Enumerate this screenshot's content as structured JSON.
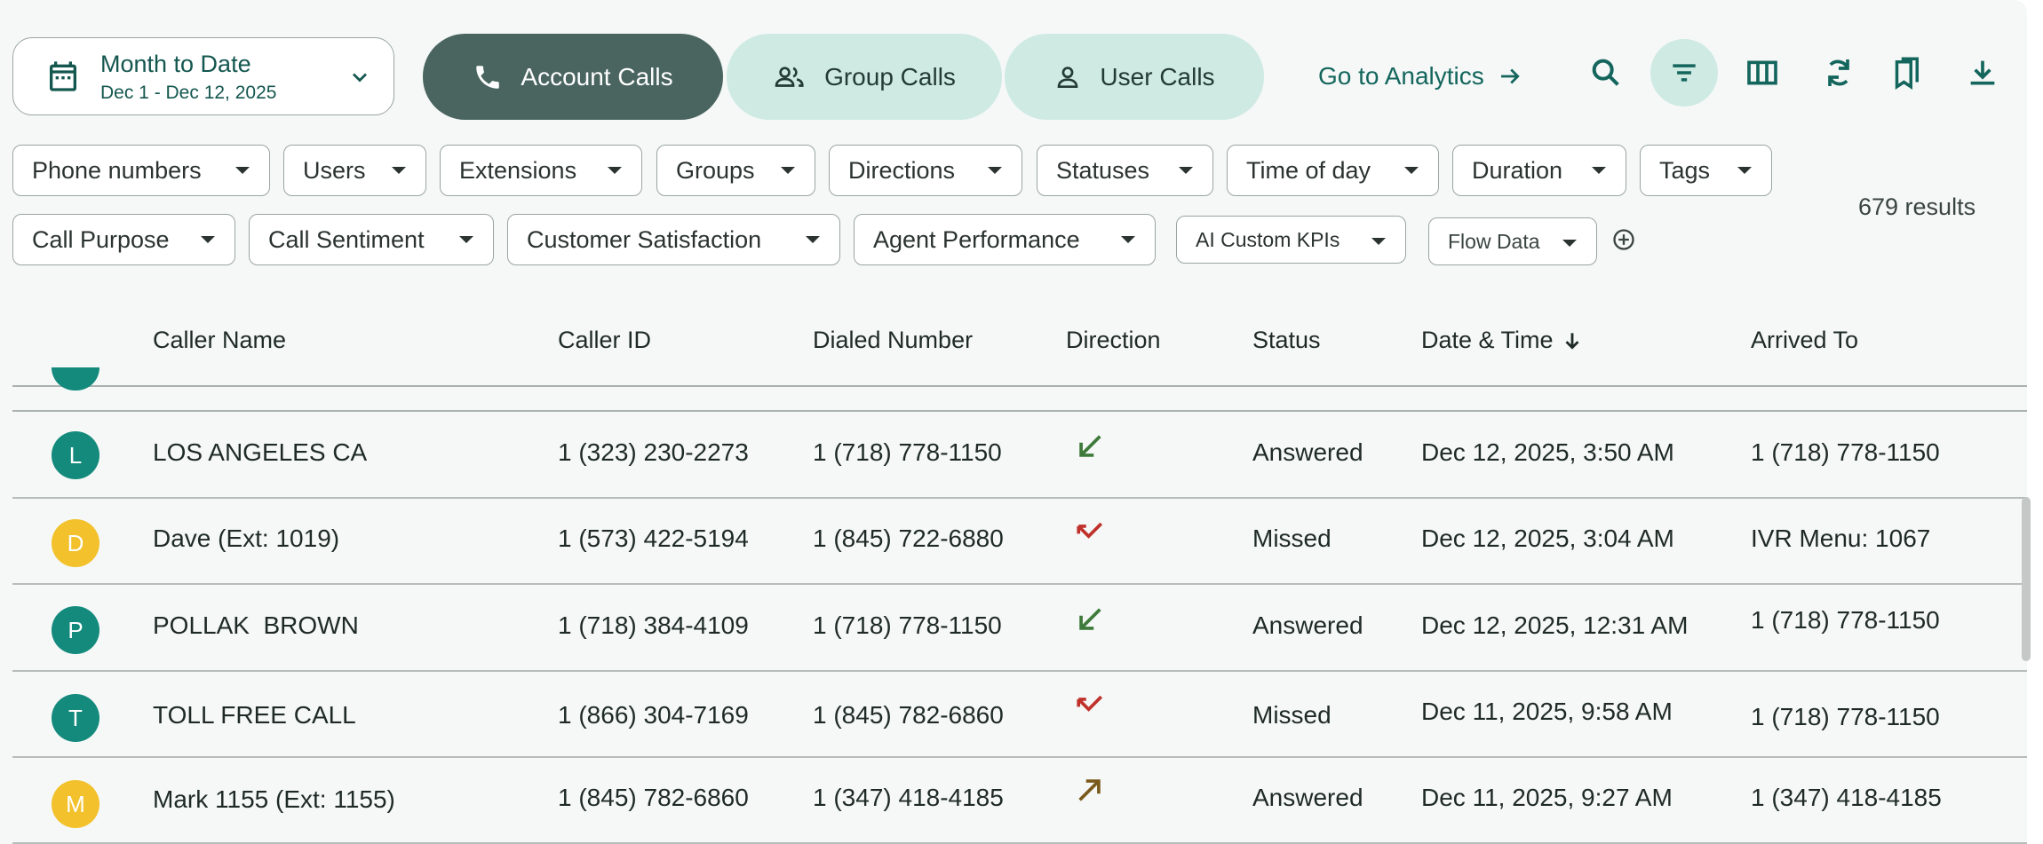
{
  "date_range": {
    "title": "Month to Date",
    "range": "Dec 1 - Dec 12, 2025"
  },
  "tabs": [
    {
      "label": "Account Calls",
      "active": true
    },
    {
      "label": "Group Calls",
      "active": false
    },
    {
      "label": "User Calls",
      "active": false
    }
  ],
  "analytics_link": "Go to Analytics",
  "toolbar_icons": [
    "search-icon",
    "filter-icon",
    "columns-icon",
    "refresh-icon",
    "bookmarks-icon",
    "download-icon"
  ],
  "filters_row1": [
    "Phone numbers",
    "Users",
    "Extensions",
    "Groups",
    "Directions",
    "Statuses",
    "Time of day",
    "Duration",
    "Tags"
  ],
  "filters_row2": [
    "Call Purpose",
    "Call Sentiment",
    "Customer Satisfaction",
    "Agent Performance",
    "AI Custom KPIs",
    "Flow Data"
  ],
  "results": "679 results",
  "columns": [
    "Caller Name",
    "Caller ID",
    "Dialed Number",
    "Direction",
    "Status",
    "Date & Time",
    "Arrived To"
  ],
  "sort": {
    "column": "Date & Time",
    "order": "descending"
  },
  "rows": [
    {
      "initial": "L",
      "name": "LOS ANGELES CA",
      "caller_id": "1 (323) 230-2273",
      "dialed": "1 (718) 778-1150",
      "direction": "incoming",
      "status": "Answered",
      "datetime": "Dec 12, 2025, 3:50 AM",
      "arrived": "1 (718) 778-1150"
    },
    {
      "initial": "D",
      "name": "Dave (Ext: 1019)",
      "caller_id": "1 (573) 422-5194",
      "dialed": "1 (845) 722-6880",
      "direction": "missed",
      "status": "Missed",
      "datetime": "Dec 12, 2025, 3:04 AM",
      "arrived": "IVR Menu: 1067"
    },
    {
      "initial": "P",
      "name": "POLLAK  BROWN",
      "caller_id": "1 (718) 384-4109",
      "dialed": "1 (718) 778-1150",
      "direction": "incoming",
      "status": "Answered",
      "datetime": "Dec 12, 2025, 12:31 AM",
      "arrived": "1 (718) 778-1150"
    },
    {
      "initial": "T",
      "name": "TOLL FREE CALL",
      "caller_id": "1 (866) 304-7169",
      "dialed": "1 (845) 782-6860",
      "direction": "missed",
      "status": "Missed",
      "datetime": "Dec 11, 2025, 9:58 AM",
      "arrived": "1 (718) 778-1150"
    },
    {
      "initial": "M",
      "name": "Mark 1155 (Ext: 1155)",
      "caller_id": "1 (845) 782-6860",
      "dialed": "1 (347) 418-4185",
      "direction": "outgoing",
      "status": "Answered",
      "datetime": "Dec 11, 2025, 9:27 AM",
      "arrived": "1 (347) 418-4185"
    }
  ],
  "colors": {
    "teal_avatar": "#138a7c",
    "yellow_avatar": "#f2c12b",
    "incoming": "#3e7a3a",
    "missed": "#c0312b",
    "outgoing": "#7a5a1c",
    "active_tab": "#4a655f",
    "inactive_tab": "#cfeae3"
  }
}
